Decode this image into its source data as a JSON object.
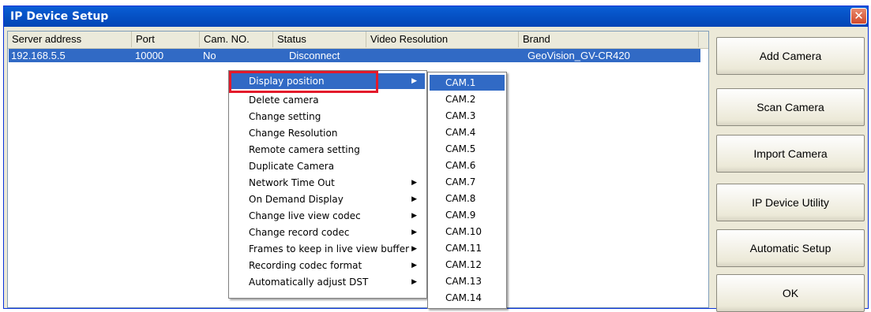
{
  "window": {
    "title": "IP Device Setup",
    "close_glyph": "✕"
  },
  "table": {
    "headers": [
      "Server address",
      "Port",
      "Cam. NO.",
      "Status",
      "Video Resolution",
      "Brand"
    ],
    "rows": [
      {
        "server": "192.168.5.5",
        "port": "10000",
        "cam_no": "No",
        "status": "Disconnect",
        "resolution": "",
        "brand": "GeoVision_GV-CR420"
      }
    ]
  },
  "context_menu": {
    "items": [
      {
        "label": "Display position",
        "submenu": true
      },
      {
        "label": "Delete camera",
        "submenu": false
      },
      {
        "label": "Change setting",
        "submenu": false
      },
      {
        "label": "Change Resolution",
        "submenu": false
      },
      {
        "label": "Remote camera setting",
        "submenu": false
      },
      {
        "label": "Duplicate Camera",
        "submenu": false
      },
      {
        "label": "Network Time Out",
        "submenu": true
      },
      {
        "label": "On Demand Display",
        "submenu": true
      },
      {
        "label": "Change live view codec",
        "submenu": true
      },
      {
        "label": "Change record codec",
        "submenu": true
      },
      {
        "label": "Frames to keep in live view buffer",
        "submenu": true
      },
      {
        "label": "Recording codec format",
        "submenu": true
      },
      {
        "label": "Automatically adjust DST",
        "submenu": true
      }
    ],
    "submenu_arrow": "▶"
  },
  "submenu": {
    "items": [
      "CAM.1",
      "CAM.2",
      "CAM.3",
      "CAM.4",
      "CAM.5",
      "CAM.6",
      "CAM.7",
      "CAM.8",
      "CAM.9",
      "CAM.10",
      "CAM.11",
      "CAM.12",
      "CAM.13",
      "CAM.14"
    ]
  },
  "buttons": {
    "add_camera": "Add Camera",
    "scan_camera": "Scan Camera",
    "import_camera": "Import Camera",
    "ip_device_utility": "IP Device Utility",
    "automatic_setup": "Automatic Setup",
    "ok": "OK"
  },
  "colors": {
    "selection": "#316ac5",
    "highlight_box": "#e31a2b",
    "titlebar": "#0653c7"
  }
}
